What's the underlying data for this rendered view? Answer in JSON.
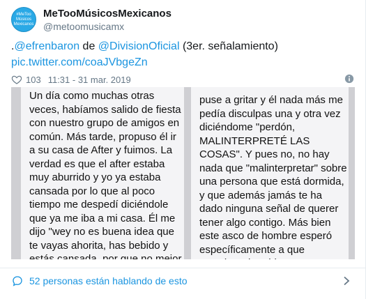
{
  "account": {
    "display_name": "MeTooMúsicosMexicanos",
    "handle": "@metoomusicamx",
    "avatar_text": "#MeToo Músicos Mexicanos"
  },
  "tweet": {
    "prefix": ".",
    "mention1": "@efrenbaron",
    "word_de": " de ",
    "mention2": "@DivisionOficial",
    "suffix": " (3er. señalamiento)",
    "pic_link": "pic.twitter.com/coaJVbgeZn"
  },
  "meta": {
    "like_count": "103",
    "timestamp": "11:31 - 31 mar. 2019"
  },
  "media": {
    "left_text": "Un día como muchas otras veces, habíamos salido de fiesta con nuestro grupo de amigos en común. Más tarde, propuso él ir a su casa de After y fuimos. La verdad es que el after estaba muy aburrido y yo ya estaba cansada por lo que al poco tiempo me despedí diciéndole que ya me iba a mi casa. Él me dijo \"wey no es buena idea que te vayas ahorita, has bebido y estás cansada, por que no mejor te acuestas un rato y ya",
    "right_text": "puse a gritar y él nada más me pedía disculpas una y otra vez diciéndome \"perdón, MALINTERPRETÉ LAS COSAS\". Y pues no, no hay nada que \"malinterpretar\" sobre una persona que está dormida, y que además jamás te ha dado ninguna señal de querer tener algo contigo. Más bien este asco de hombre esperó específicamente a que estuviera dormida para aprovecharse. No"
  },
  "conversation": {
    "label": "52 personas están hablando de esto"
  },
  "icons": {
    "like": "heart-icon",
    "info": "info-icon",
    "conversation": "chat-bubble-icon",
    "more": "chevron-right-icon"
  },
  "colors": {
    "link": "#1b95e0",
    "muted": "#657786",
    "avatar": "#2aa9e6"
  }
}
